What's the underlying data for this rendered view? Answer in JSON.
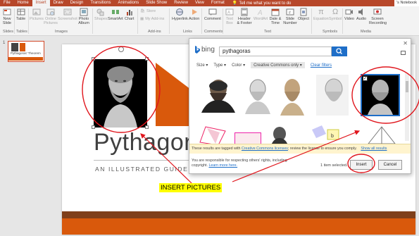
{
  "ribbon": {
    "tabs": [
      "File",
      "Home",
      "Insert",
      "Draw",
      "Design",
      "Transitions",
      "Animations",
      "Slide Show",
      "Review",
      "View",
      "Format"
    ],
    "active_tab": "Insert",
    "tell_me": "Tell me what you want to do",
    "notebook": "'s Notebook",
    "groups": {
      "slides": {
        "new_slide": "New Slide",
        "label": "Slides"
      },
      "tables": {
        "table": "Table",
        "label": "Tables"
      },
      "images": {
        "pictures": "Pictures",
        "online": "Online Pictures",
        "screenshot": "Screenshot",
        "album": "Photo Album",
        "label": "Images"
      },
      "illustrations": {
        "shapes": "Shapes",
        "smartart": "SmartArt",
        "chart": "Chart"
      },
      "addins": {
        "store": "Store",
        "myaddins": "My Add-ins",
        "label": "Add-ins"
      },
      "links": {
        "hyperlink": "Hyperlink",
        "action": "Action",
        "label": "Links"
      },
      "comments": {
        "comment": "Comment",
        "label": "Comments"
      },
      "text": {
        "textbox": "Text Box",
        "header": "Header & Footer",
        "wordart": "WordArt",
        "datetime": "Date & Time",
        "slidenum": "Slide Number",
        "object": "Object",
        "label": "Text"
      },
      "symbols": {
        "equation": "Equation",
        "symbol": "Symbol",
        "label": "Symbols"
      },
      "media": {
        "video": "Video",
        "audio": "Audio",
        "recording": "Screen Recording",
        "label": "Media"
      }
    }
  },
  "thumbnails": {
    "number": "1",
    "caption": "Pythagoras' Theorem"
  },
  "slide": {
    "title": "Pythagor",
    "subtitle": "AN ILLUSTRATED GUIDE"
  },
  "dialog": {
    "brand": "bing",
    "query": "pythagoras",
    "filters": [
      "Size",
      "Type",
      "Color"
    ],
    "license_filter": "Creative Commons only",
    "clear_filters": "Clear filters",
    "warning_prefix": "These results are tagged with ",
    "warning_link": "Creative Commons licenses",
    "warning_suffix": "; review the license to ensure you comply.",
    "show_all": "Show all results",
    "responsibility": "You are responsible for respecting others' rights, including copyright. ",
    "learn_more": "Learn more here.",
    "selected": "1 item selected.",
    "insert": "Insert",
    "cancel": "Cancel"
  },
  "annotation": {
    "label": "INSERT PICTURES",
    "color": "#ffff00",
    "circle_color": "#e0161d"
  },
  "colors": {
    "accent": "#b7472a",
    "slide_orange": "#d9590c",
    "slide_brown": "#7f3f1a",
    "bing_blue": "#1e6ec8"
  }
}
